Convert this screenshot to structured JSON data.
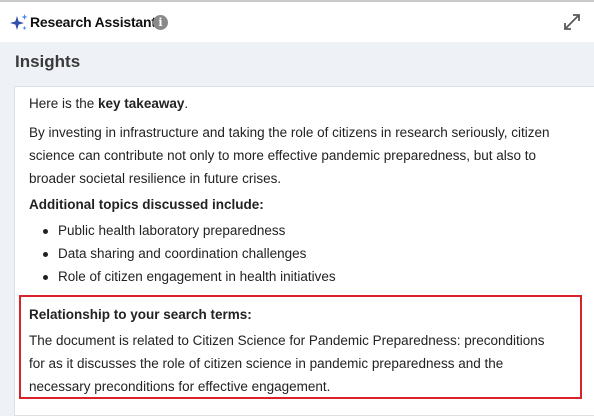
{
  "header": {
    "title": "Research Assistant",
    "info_glyph": "i",
    "icons": [
      "sparkle-icon",
      "info-icon",
      "expand-icon"
    ]
  },
  "section_title": "Insights",
  "takeaway": {
    "prefix": "Here is the ",
    "bold": "key takeaway",
    "suffix": "."
  },
  "summary_lines": [
    "By investing in infrastructure and taking the role of citizens in research seriously, citizen",
    "science can contribute not only to more effective pandemic preparedness, but also to",
    "broader societal resilience in future crises."
  ],
  "additional": {
    "heading": "Additional topics discussed include:",
    "items": [
      "Public health laboratory preparedness",
      "Data sharing and coordination challenges",
      "Role of citizen engagement in health initiatives"
    ]
  },
  "relationship": {
    "heading": "Relationship to your search terms:",
    "lines": [
      "The document is related to Citizen Science for Pandemic Preparedness: preconditions",
      "for as it discusses the role of citizen science in pandemic preparedness and the",
      "necessary preconditions for effective engagement."
    ]
  },
  "colors": {
    "accent": "#3b6ed8",
    "highlight_border": "#d9232a"
  }
}
